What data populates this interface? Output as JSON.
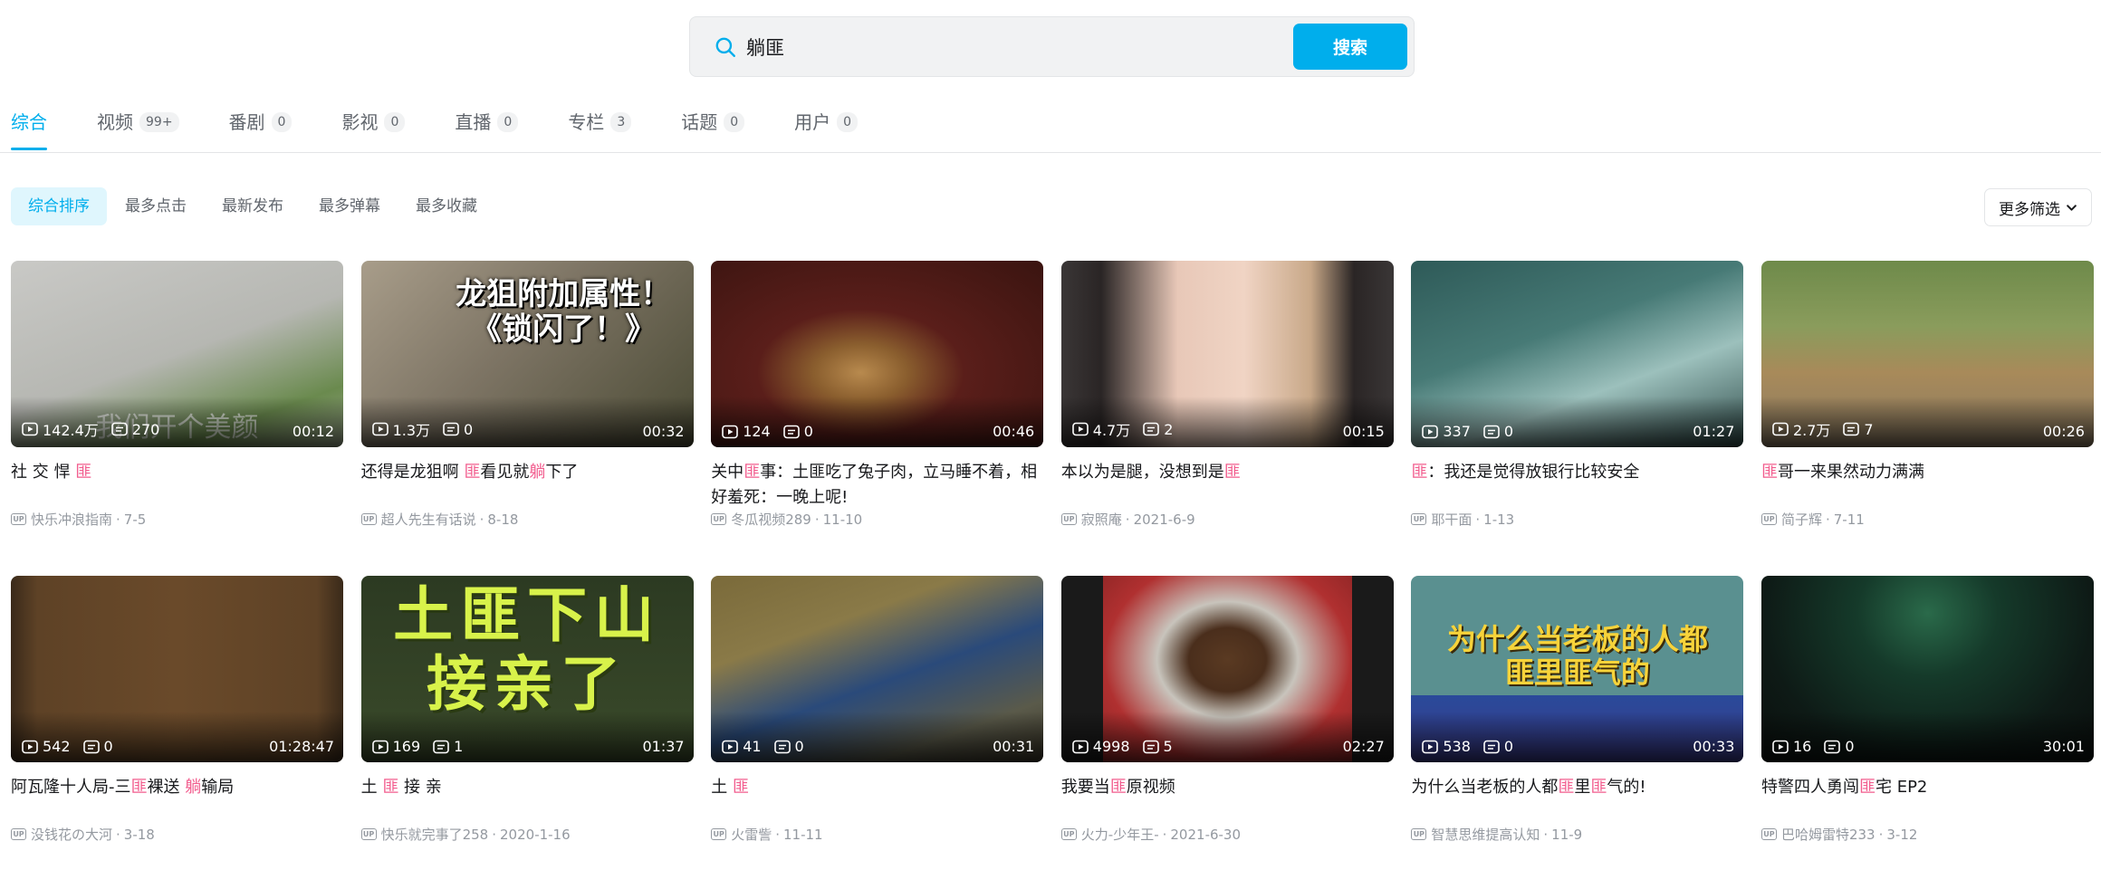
{
  "search": {
    "value": "躺匪",
    "button_label": "搜索"
  },
  "tabs": [
    {
      "label": "综合",
      "count": "",
      "active": true
    },
    {
      "label": "视频",
      "count": "99+"
    },
    {
      "label": "番剧",
      "count": "0"
    },
    {
      "label": "影视",
      "count": "0"
    },
    {
      "label": "直播",
      "count": "0"
    },
    {
      "label": "专栏",
      "count": "3"
    },
    {
      "label": "话题",
      "count": "0"
    },
    {
      "label": "用户",
      "count": "0"
    }
  ],
  "sorts": [
    {
      "label": "综合排序",
      "active": true
    },
    {
      "label": "最多点击"
    },
    {
      "label": "最新发布"
    },
    {
      "label": "最多弹幕"
    },
    {
      "label": "最多收藏"
    }
  ],
  "more_filter_label": "更多筛选",
  "colors": {
    "accent": "#00aeec",
    "highlight": "#f25d8e"
  },
  "videos": [
    {
      "title": [
        [
          "社 交 悍 ",
          0
        ],
        [
          "匪",
          1
        ]
      ],
      "views": "142.4万",
      "danmaku": "270",
      "duration": "00:12",
      "author": "快乐冲浪指南",
      "date": "7-5",
      "thumb_text": "我们开个美颜",
      "bg": "linear-gradient(160deg,#c9c9c6 0%,#b6b7b2 50%,#6a8a4e 80%,#99a48a 100%)",
      "thumb_text_style": "bottom"
    },
    {
      "title": [
        [
          "还得是龙狙啊 ",
          0
        ],
        [
          "匪",
          1
        ],
        [
          "看见就",
          0
        ],
        [
          "躺",
          1
        ],
        [
          "下了",
          0
        ]
      ],
      "views": "1.3万",
      "danmaku": "0",
      "duration": "00:32",
      "author": "超人先生有话说",
      "date": "8-18",
      "thumb_text": "龙狙附加属性！《锁闪了！》",
      "bg": "linear-gradient(135deg,#a89d8a 0%,#7d7464 45%,#4a4a34 100%)",
      "thumb_text_style": "cs"
    },
    {
      "title": [
        [
          "关中",
          0
        ],
        [
          "匪",
          1
        ],
        [
          "事：土匪吃了兔子肉，立马睡不着，相好羞死：一晚上呢!",
          0
        ]
      ],
      "views": "124",
      "danmaku": "0",
      "duration": "00:46",
      "author": "冬瓜视频289",
      "date": "11-10",
      "thumb_text": "",
      "bg": "radial-gradient(ellipse at 45% 60%,#b88a4e 0%,#8a5e2e 18%,#5a1e1a 40%,#3a1410 100%)",
      "thumb_text_style": ""
    },
    {
      "title": [
        [
          "本以为是腿，没想到是",
          0
        ],
        [
          "匪",
          1
        ]
      ],
      "views": "4.7万",
      "danmaku": "2",
      "duration": "00:15",
      "author": "寂照庵",
      "date": "2021-6-9",
      "thumb_text": "",
      "bg": "linear-gradient(90deg,#3a3636 0%,#2a2525 12%,#e8c8b8 35%,#f0d4c4 55%,#c8a888 75%,#2a2525 88%,#3a3636 100%)",
      "thumb_text_style": ""
    },
    {
      "title": [
        [
          "匪",
          1
        ],
        [
          "：我还是觉得放银行比较安全",
          0
        ]
      ],
      "views": "337",
      "danmaku": "0",
      "duration": "01:27",
      "author": "耶干面",
      "date": "1-13",
      "thumb_text": "",
      "bg": "linear-gradient(160deg,#2e5a58 0%,#477a76 40%,#9cc0bc 65%,#2e4a48 100%)",
      "thumb_text_style": ""
    },
    {
      "title": [
        [
          "匪",
          1
        ],
        [
          "哥一来果然动力满满",
          0
        ]
      ],
      "views": "2.7万",
      "danmaku": "7",
      "duration": "00:26",
      "author": "简子辉",
      "date": "7-11",
      "thumb_text": "",
      "bg": "linear-gradient(180deg,#6e8a4a 0%,#8a9c5c 35%,#a88a5a 60%,#8a7a62 100%)",
      "thumb_text_style": ""
    },
    {
      "title": [
        [
          "阿瓦隆十人局-三",
          0
        ],
        [
          "匪",
          1
        ],
        [
          "裸送 ",
          0
        ],
        [
          "躺",
          1
        ],
        [
          "输局",
          0
        ]
      ],
      "views": "542",
      "danmaku": "0",
      "duration": "01:28:47",
      "author": "没钱花の大河",
      "date": "3-18",
      "thumb_text": "",
      "bg": "linear-gradient(90deg,#3a2a1a 0%,#5e4226 8%,#6a4a2a 50%,#5e4226 92%,#3a2a1a 100%)",
      "thumb_text_style": ""
    },
    {
      "title": [
        [
          "土 ",
          0
        ],
        [
          "匪",
          1
        ],
        [
          " 接 亲",
          0
        ]
      ],
      "views": "169",
      "danmaku": "1",
      "duration": "01:37",
      "author": "快乐就完事了258",
      "date": "2020-1-16",
      "thumb_text": "土匪下山接亲了",
      "bg": "linear-gradient(180deg,#2c3a22 0%,#3a4a2a 100%)",
      "thumb_text_style": "green"
    },
    {
      "title": [
        [
          "土 ",
          0
        ],
        [
          "匪",
          1
        ]
      ],
      "views": "41",
      "danmaku": "0",
      "duration": "00:31",
      "author": "火雷訾",
      "date": "11-11",
      "thumb_text": "",
      "bg": "linear-gradient(160deg,#7a6a3a 0%,#8a7a48 30%,#2a4a7a 55%,#5a5a4a 80%,#3a3528 100%)",
      "thumb_text_style": ""
    },
    {
      "title": [
        [
          "我要当",
          0
        ],
        [
          "匪",
          1
        ],
        [
          "原视频",
          0
        ]
      ],
      "views": "4998",
      "danmaku": "5",
      "duration": "02:27",
      "author": "火力-少年王-",
      "date": "2021-6-30",
      "thumb_text": "",
      "bg": "linear-gradient(180deg,#1a1a1a 0%,#1a1a1a 100%)",
      "thumb_text_style": "boy"
    },
    {
      "title": [
        [
          "为什么当老板的人都",
          0
        ],
        [
          "匪",
          1
        ],
        [
          "里",
          0
        ],
        [
          "匪",
          1
        ],
        [
          "气的!",
          0
        ]
      ],
      "views": "538",
      "danmaku": "0",
      "duration": "00:33",
      "author": "智慧思维提高认知",
      "date": "11-9",
      "thumb_text": "为什么当老板的人都匪里匪气的",
      "bg": "linear-gradient(180deg,#5a9090 0%,#5a9090 64%,#2a4a9a 64%,#3a3a8a 100%)",
      "thumb_text_style": "yellow"
    },
    {
      "title": [
        [
          "特警四人勇闯",
          0
        ],
        [
          "匪",
          1
        ],
        [
          "宅 EP2",
          0
        ]
      ],
      "views": "16",
      "danmaku": "0",
      "duration": "30:01",
      "author": "巴哈姆雷特233",
      "date": "3-12",
      "thumb_text": "",
      "bg": "radial-gradient(ellipse at 50% 20%,#2a6a4a 0%,#153a2a 30%,#0e1a16 70%,#0a0f0d 100%)",
      "thumb_text_style": ""
    }
  ]
}
